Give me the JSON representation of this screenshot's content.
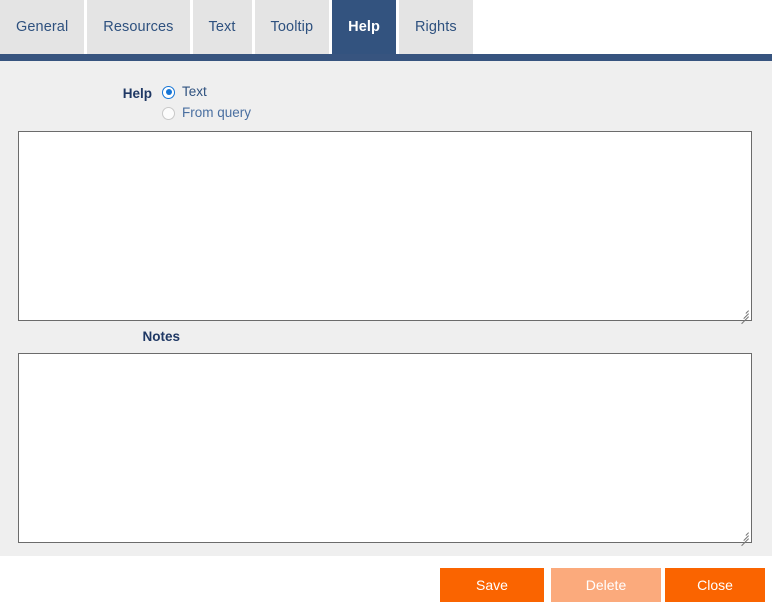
{
  "tabs": [
    {
      "label": "General",
      "active": false
    },
    {
      "label": "Resources",
      "active": false
    },
    {
      "label": "Text",
      "active": false
    },
    {
      "label": "Tooltip",
      "active": false
    },
    {
      "label": "Help",
      "active": true
    },
    {
      "label": "Rights",
      "active": false
    }
  ],
  "form": {
    "help_label": "Help",
    "radio_text_label": "Text",
    "radio_query_label": "From query",
    "selected_option": "Text",
    "help_textarea_value": "",
    "help_textarea_placeholder": "",
    "notes_label": "Notes",
    "notes_textarea_value": "",
    "notes_textarea_placeholder": ""
  },
  "footer": {
    "save_label": "Save",
    "delete_label": "Delete",
    "close_label": "Close"
  },
  "colors": {
    "tab_active_bg": "#33537f",
    "tab_inactive_bg": "#e4e4e4",
    "tab_text": "#2e517f",
    "rule": "#37547f",
    "panel_bg": "#efefef",
    "accent_orange": "#fa6400",
    "accent_orange_disabled": "#fbaa7c",
    "label_navy": "#1f3864",
    "radio_blue": "#1675d6"
  }
}
